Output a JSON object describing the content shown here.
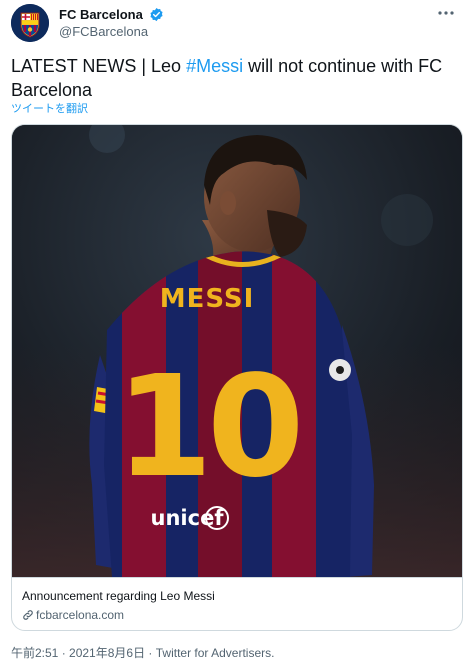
{
  "author": {
    "display_name": "FC Barcelona",
    "handle": "@FCBarcelona",
    "verified_icon": "verified-badge-icon",
    "avatar_icon": "fcb-crest-icon"
  },
  "menu_icon": "more-icon",
  "tweet": {
    "text_before": "LATEST NEWS | Leo ",
    "hashtag": "#Messi",
    "text_after": " will not continue with FC Barcelona",
    "translate_label": "ツイートを翻訳"
  },
  "card": {
    "image_icon": "player-photo",
    "jersey_name": "MESSI",
    "jersey_number": "10",
    "sponsor": "unicef",
    "title": "Announcement regarding Leo Messi",
    "domain": "fcbarcelona.com",
    "link_icon": "link-icon"
  },
  "meta": {
    "time": "午前2:51",
    "date": "2021年8月6日",
    "source": "Twitter for Advertisers.",
    "separator": " · "
  },
  "colors": {
    "accent": "#1d9bf0",
    "text": "#0f1419",
    "secondary_text": "#536471",
    "border": "#cfd9de"
  }
}
